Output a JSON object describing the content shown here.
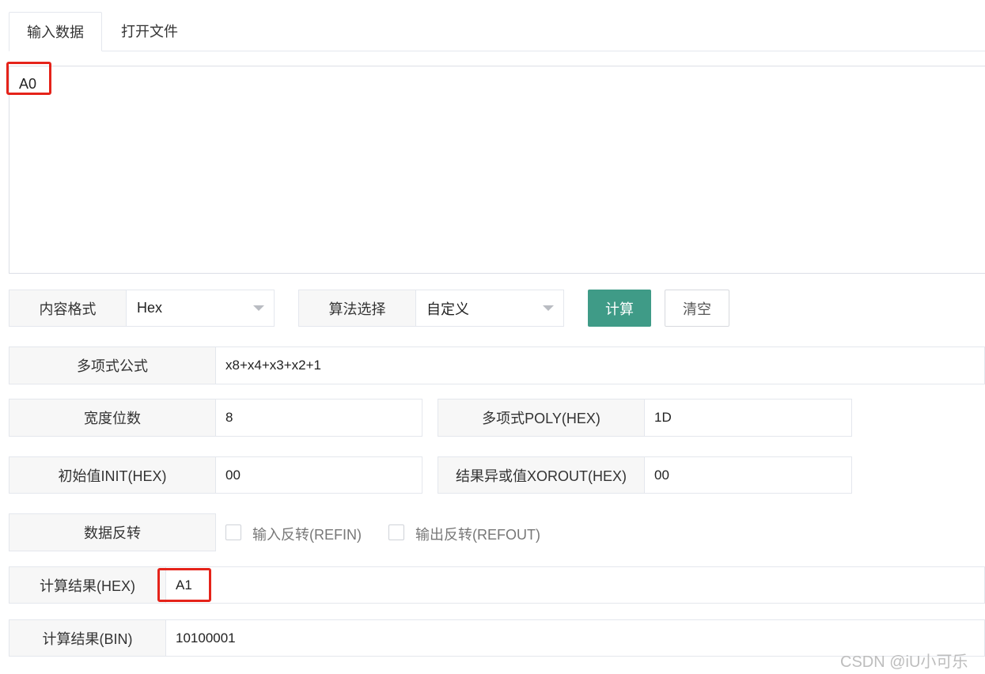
{
  "tabs": {
    "input_data": "输入数据",
    "open_file": "打开文件"
  },
  "input": {
    "value": "A0"
  },
  "format": {
    "label": "内容格式",
    "value": "Hex"
  },
  "algorithm": {
    "label": "算法选择",
    "value": "自定义"
  },
  "buttons": {
    "compute": "计算",
    "clear": "清空"
  },
  "polynomial_formula": {
    "label": "多项式公式",
    "value": "x8+x4+x3+x2+1"
  },
  "width": {
    "label": "宽度位数",
    "value": "8"
  },
  "poly": {
    "label": "多项式POLY(HEX)",
    "value": "1D"
  },
  "init": {
    "label": "初始值INIT(HEX)",
    "value": "00"
  },
  "xorout": {
    "label": "结果异或值XOROUT(HEX)",
    "value": "00"
  },
  "reverse": {
    "label": "数据反转",
    "refin": "输入反转(REFIN)",
    "refout": "输出反转(REFOUT)"
  },
  "result_hex": {
    "label": "计算结果(HEX)",
    "value": "A1"
  },
  "result_bin": {
    "label": "计算结果(BIN)",
    "value": "10100001"
  },
  "watermark": "CSDN @iU小可乐",
  "colors": {
    "primary": "#3f9b87",
    "highlight": "#e5231a"
  }
}
